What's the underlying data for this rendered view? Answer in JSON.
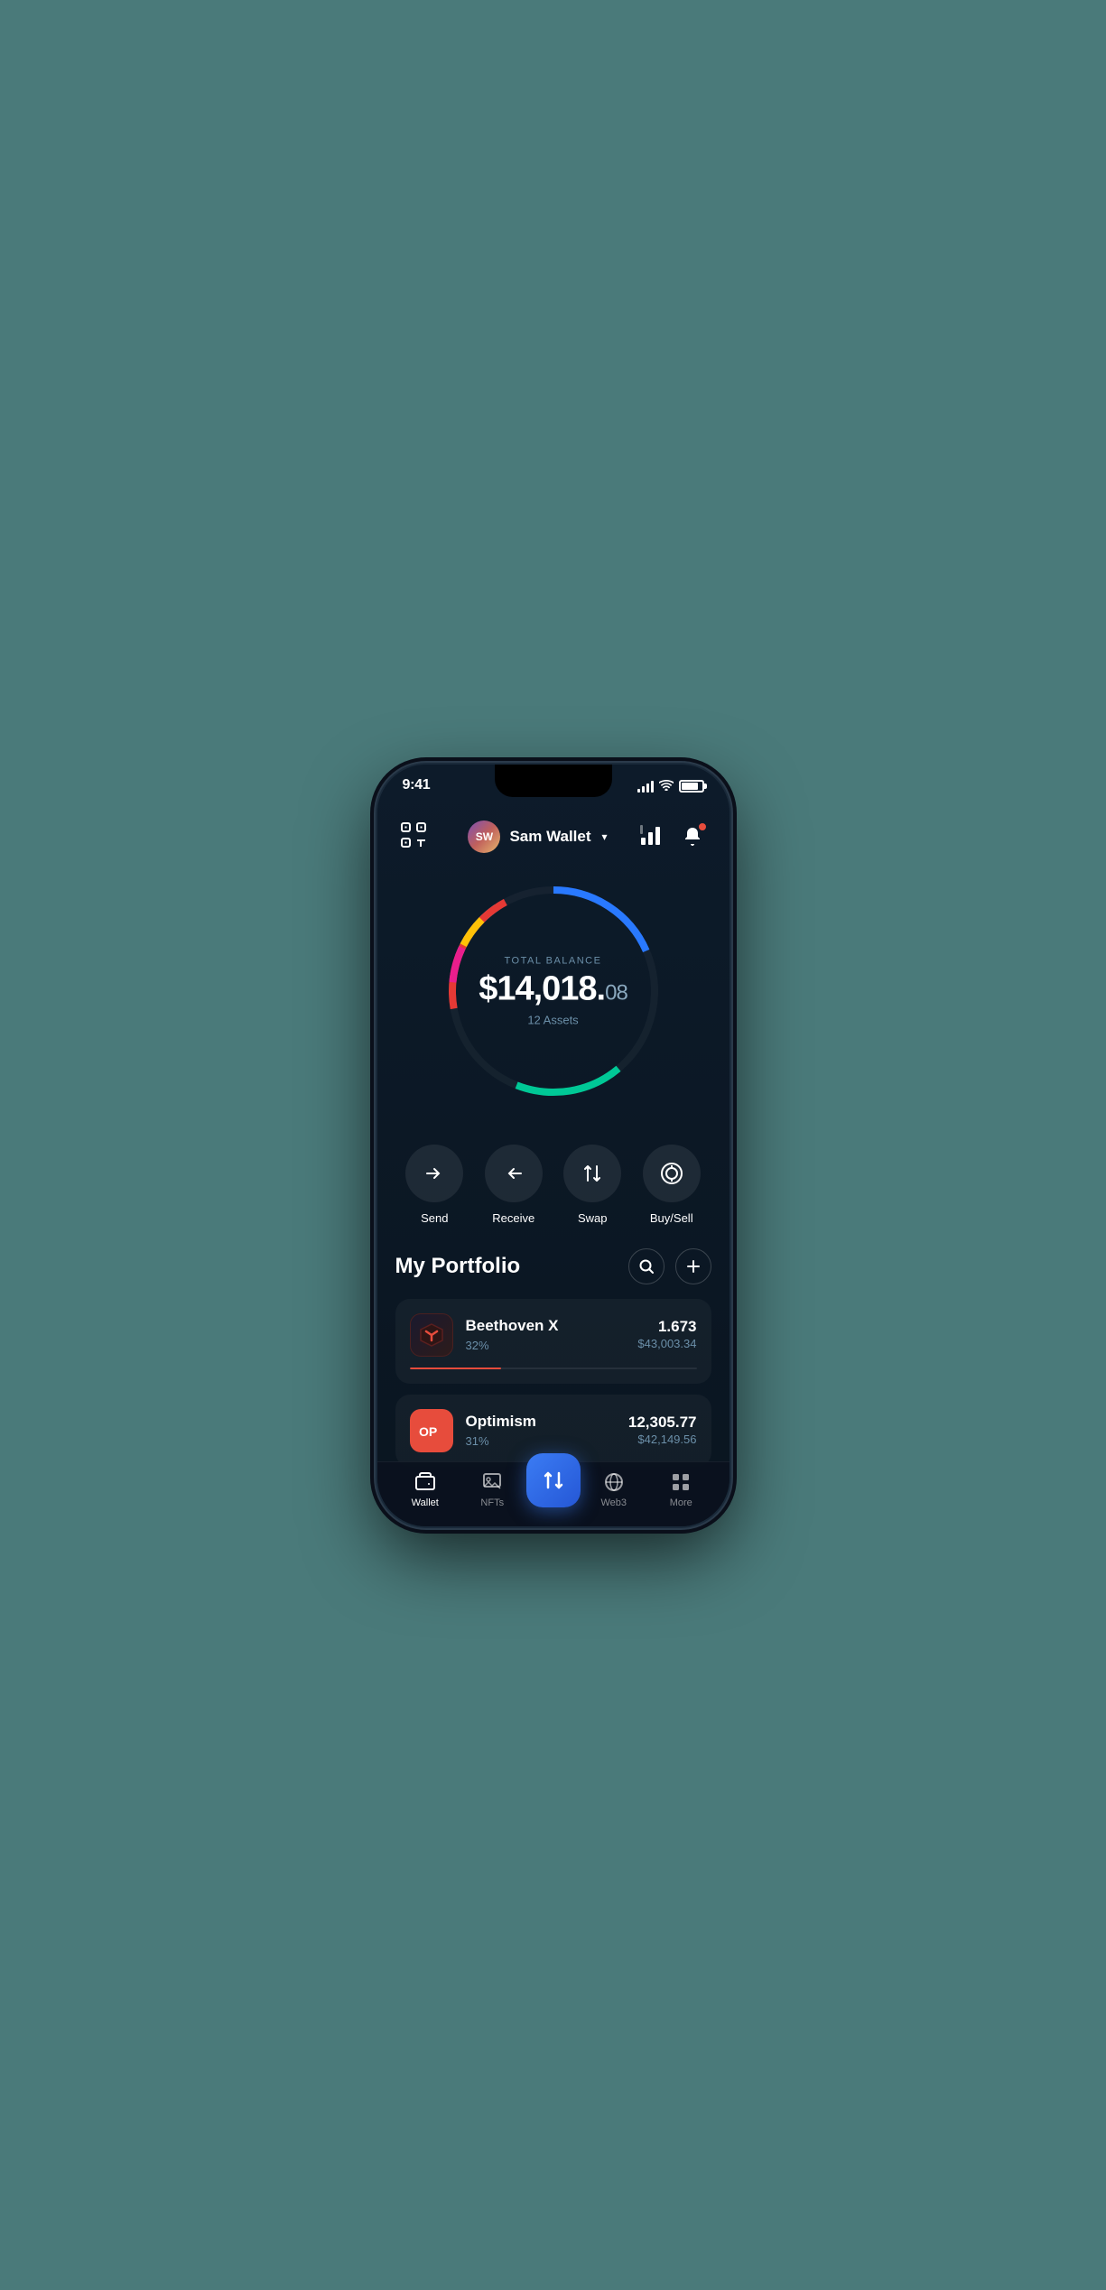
{
  "statusBar": {
    "time": "9:41"
  },
  "header": {
    "walletInitials": "SW",
    "walletName": "Sam Wallet",
    "chevron": "▾"
  },
  "balance": {
    "label": "TOTAL BALANCE",
    "amountMain": "$14,018.",
    "amountCents": "08",
    "assetsCount": "12 Assets"
  },
  "actions": [
    {
      "id": "send",
      "label": "Send",
      "icon": "→"
    },
    {
      "id": "receive",
      "label": "Receive",
      "icon": "←"
    },
    {
      "id": "swap",
      "label": "Swap",
      "icon": "⇅"
    },
    {
      "id": "buysell",
      "label": "Buy/Sell",
      "icon": "⊙"
    }
  ],
  "portfolio": {
    "title": "My Portfolio",
    "items": [
      {
        "id": "beethoven",
        "name": "Beethoven X",
        "percent": "32%",
        "amount": "1.673",
        "usd": "$43,003.34",
        "progressWidth": "32",
        "progressColor": "#e74c3c",
        "logoText": "✕",
        "logoType": "beethoven"
      },
      {
        "id": "optimism",
        "name": "Optimism",
        "percent": "31%",
        "amount": "12,305.77",
        "usd": "$42,149.56",
        "progressWidth": "31",
        "progressColor": "#e74c3c",
        "logoText": "OP",
        "logoType": "optimism"
      }
    ]
  },
  "bottomNav": {
    "items": [
      {
        "id": "wallet",
        "label": "Wallet",
        "icon": "💳",
        "active": true
      },
      {
        "id": "nfts",
        "label": "NFTs",
        "icon": "🖼"
      },
      {
        "id": "web3",
        "label": "Web3",
        "icon": "🌐"
      },
      {
        "id": "more",
        "label": "More",
        "icon": "⊞"
      }
    ],
    "centerIcon": "⇅"
  }
}
